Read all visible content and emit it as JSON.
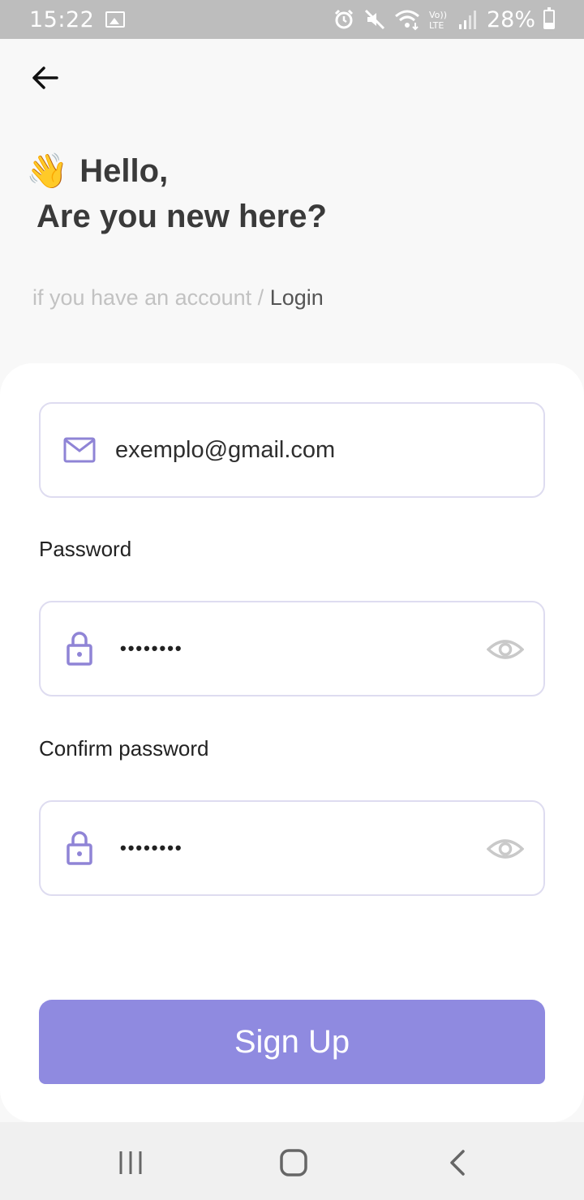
{
  "status_bar": {
    "time": "15:22",
    "battery": "28%",
    "icons": [
      "gallery-icon",
      "alarm-icon",
      "mute-icon",
      "wifi-icon",
      "volte-icon",
      "signal-icon",
      "battery-icon"
    ]
  },
  "header": {
    "back_icon": "arrow-left-icon",
    "wave_emoji": "👋",
    "greeting_line1": "Hello,",
    "greeting_line2": "Are you new here?",
    "login_hint_prefix": "if you have an account / ",
    "login_link": "Login"
  },
  "form": {
    "email": {
      "icon": "mail-icon",
      "value": "exemplo@gmail.com"
    },
    "password": {
      "label": "Password",
      "icon": "lock-icon",
      "value": "••••••••",
      "toggle_icon": "eye-icon"
    },
    "confirm_password": {
      "label": "Confirm password",
      "icon": "lock-icon",
      "value": "••••••••",
      "toggle_icon": "eye-icon"
    },
    "submit_label": "Sign Up"
  },
  "nav_bar": {
    "items": [
      "recents-icon",
      "home-icon",
      "back-icon"
    ]
  },
  "colors": {
    "accent": "#8f8ae0",
    "icon_purple": "#8f84d6",
    "field_border": "#dedcf0",
    "status_bar": "#bdbdbd"
  }
}
